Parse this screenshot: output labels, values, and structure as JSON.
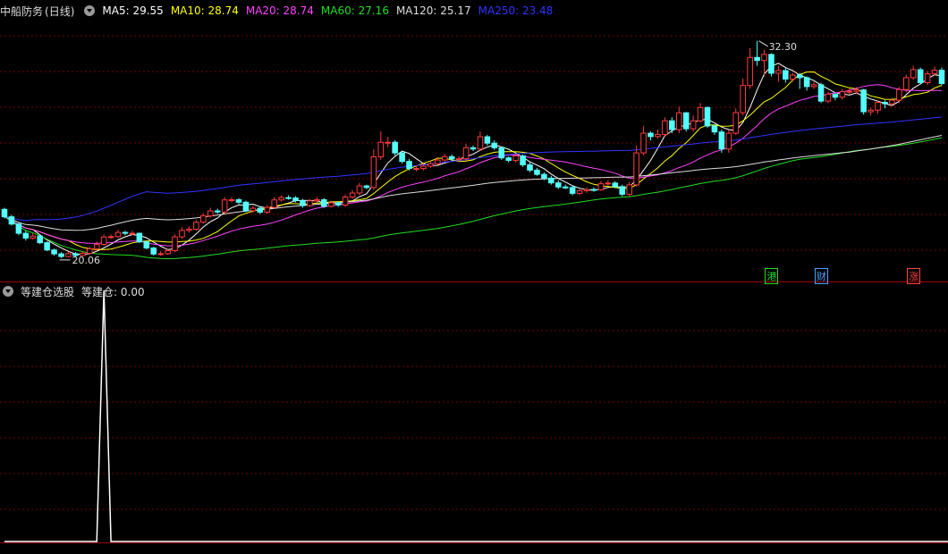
{
  "main_header": {
    "stock_name": "中船防务",
    "period": "(日线)",
    "ma_items": [
      {
        "label": "MA5: 29.55",
        "color": "#ffffff"
      },
      {
        "label": "MA10: 28.74",
        "color": "#ffff00"
      },
      {
        "label": "MA20: 28.74",
        "color": "#ff44ff"
      },
      {
        "label": "MA60: 27.16",
        "color": "#22dd22"
      },
      {
        "label": "MA120: 25.17",
        "color": "#dddddd"
      },
      {
        "label": "MA250: 23.48",
        "color": "#3333ff"
      }
    ]
  },
  "indicator_header": {
    "name": "等建仓选股",
    "value_label": "等建仓: 0.00"
  },
  "annotations": {
    "high_label": "32.30",
    "low_label": "20.06"
  },
  "events": [
    {
      "label": "港",
      "color": "#22dd22"
    },
    {
      "label": "财",
      "color": "#4aa0ff"
    },
    {
      "label": "涨",
      "color": "#ff4444"
    }
  ],
  "colors": {
    "up": "#ff3c3c",
    "down": "#54ffff",
    "grid": "#7a0000",
    "divider": "#a00000",
    "indicator_line": "#ffffff"
  },
  "chart_data": [
    {
      "type": "candlestick",
      "title": "中船防务 (日线)",
      "ylim": [
        19.5,
        33.5
      ],
      "x": [
        1,
        2,
        3,
        4,
        5,
        6,
        7,
        8,
        9,
        10,
        11,
        12,
        13,
        14,
        15,
        16,
        17,
        18,
        19,
        20,
        21,
        22,
        23,
        24,
        25,
        26,
        27,
        28,
        29,
        30,
        31,
        32,
        33,
        34,
        35,
        36,
        37,
        38,
        39,
        40,
        41,
        42,
        43,
        44,
        45,
        46,
        47,
        48,
        49,
        50,
        51,
        52,
        53,
        54,
        55,
        56,
        57,
        58,
        59,
        60,
        61,
        62,
        63,
        64,
        65,
        66,
        67,
        68,
        69,
        70,
        71,
        72,
        73,
        74,
        75,
        76,
        77,
        78,
        79,
        80,
        81,
        82,
        83,
        84,
        85,
        86,
        87,
        88,
        89,
        90,
        91,
        92,
        93,
        94,
        95,
        96,
        97,
        98,
        99,
        100,
        101,
        102,
        103,
        104,
        105,
        106,
        107,
        108,
        109,
        110,
        111,
        112,
        113,
        114,
        115,
        116,
        117,
        118,
        119,
        120,
        121,
        122,
        123,
        124,
        125,
        126,
        127,
        128,
        129,
        130,
        131,
        132,
        133,
        134,
        135,
        136,
        137,
        138,
        139,
        140,
        141,
        142,
        143,
        144,
        145,
        146,
        147,
        148,
        149,
        150,
        151,
        152,
        153,
        154,
        155,
        156,
        157,
        158,
        159,
        160,
        161,
        162,
        163,
        164,
        165,
        166,
        167,
        168,
        169,
        170,
        171,
        172,
        173,
        174,
        175
      ],
      "open": [
        22.81,
        22.39,
        21.98,
        21.46,
        21.19,
        21.3,
        20.93,
        20.52,
        20.3,
        20.15,
        20.31,
        20.21,
        20.33,
        20.58,
        20.83,
        21.25,
        21.27,
        21.51,
        21.46,
        21.46,
        20.98,
        20.63,
        20.29,
        20.31,
        20.48,
        21.26,
        21.62,
        21.69,
        22.08,
        22.44,
        22.72,
        22.66,
        23.34,
        23.35,
        23.21,
        22.73,
        22.87,
        22.65,
        22.92,
        23.34,
        23.47,
        23.45,
        23.3,
        23.02,
        23.29,
        23.35,
        22.98,
        23.18,
        23.05,
        23.5,
        23.73,
        24.13,
        24.04,
        25.77,
        26.59,
        26.59,
        25.99,
        25.51,
        25.11,
        25.11,
        25.24,
        25.38,
        25.59,
        25.78,
        25.65,
        25.66,
        26.28,
        26.21,
        26.9,
        26.54,
        26.28,
        25.71,
        25.57,
        25.82,
        25.32,
        25.02,
        24.78,
        24.57,
        24.3,
        24.07,
        24.04,
        23.71,
        23.86,
        23.93,
        23.91,
        24.25,
        24.29,
        24.09,
        23.66,
        24.19,
        25.99,
        27.1,
        26.91,
        27.03,
        27.8,
        27.3,
        28.25,
        27.35,
        27.8,
        28.55,
        27.51,
        27.17,
        26.21,
        27.1,
        28.26,
        29.79,
        31.37,
        31.2,
        31.54,
        30.48,
        30.63,
        30.15,
        30.38,
        30.23,
        29.73,
        29.83,
        28.91,
        29.3,
        29.13,
        29.44,
        29.46,
        29.54,
        28.31,
        28.4,
        28.84,
        28.76,
        28.96,
        29.56,
        30.23,
        30.68,
        29.95,
        30.45,
        30.65
      ],
      "close": [
        22.39,
        21.98,
        21.46,
        21.19,
        21.3,
        20.93,
        20.52,
        20.3,
        20.15,
        20.31,
        20.21,
        20.33,
        20.58,
        20.83,
        21.25,
        21.27,
        21.51,
        21.46,
        21.46,
        20.98,
        20.63,
        20.29,
        20.31,
        20.48,
        21.26,
        21.62,
        21.69,
        22.08,
        22.44,
        22.72,
        22.66,
        23.34,
        23.35,
        23.21,
        22.73,
        22.87,
        22.65,
        22.92,
        23.34,
        23.47,
        23.45,
        23.3,
        23.02,
        23.29,
        23.35,
        22.98,
        23.18,
        23.05,
        23.5,
        23.73,
        24.13,
        24.04,
        25.77,
        26.59,
        26.59,
        25.99,
        25.51,
        25.11,
        25.11,
        25.24,
        25.38,
        25.59,
        25.78,
        25.65,
        25.66,
        26.28,
        26.21,
        26.9,
        26.54,
        26.28,
        25.71,
        25.57,
        25.82,
        25.32,
        25.02,
        24.78,
        24.57,
        24.3,
        24.07,
        24.04,
        23.71,
        23.86,
        23.93,
        23.91,
        24.25,
        24.29,
        24.09,
        23.66,
        24.19,
        25.99,
        27.1,
        26.91,
        27.03,
        27.8,
        27.3,
        28.25,
        27.35,
        27.8,
        28.55,
        27.51,
        27.17,
        26.21,
        27.1,
        28.26,
        29.79,
        31.37,
        31.2,
        31.54,
        30.48,
        30.63,
        30.15,
        30.38,
        30.23,
        29.73,
        29.83,
        28.91,
        29.3,
        29.13,
        29.44,
        29.46,
        29.54,
        28.31,
        28.4,
        28.84,
        28.76,
        28.96,
        29.56,
        30.23,
        30.68,
        29.95,
        30.45,
        30.65,
        29.9
      ],
      "high": [
        22.9,
        22.5,
        22.1,
        21.6,
        21.45,
        21.4,
        21.0,
        20.6,
        20.4,
        20.4,
        20.4,
        20.45,
        20.7,
        21.0,
        21.4,
        21.4,
        21.65,
        21.6,
        21.6,
        21.5,
        21.05,
        20.7,
        20.45,
        20.6,
        21.4,
        21.8,
        21.85,
        22.2,
        22.6,
        22.9,
        22.85,
        23.5,
        23.5,
        23.45,
        23.3,
        23.0,
        22.95,
        23.05,
        23.5,
        23.6,
        23.6,
        23.55,
        23.4,
        23.4,
        23.5,
        23.45,
        23.3,
        23.25,
        23.65,
        23.9,
        24.3,
        24.2,
        26.2,
        27.2,
        26.9,
        26.7,
        26.1,
        25.65,
        25.3,
        25.4,
        25.5,
        25.75,
        25.95,
        25.9,
        25.8,
        26.5,
        26.4,
        27.2,
        27.0,
        26.7,
        26.35,
        25.8,
        25.95,
        25.9,
        25.45,
        25.15,
        24.9,
        24.7,
        24.45,
        24.2,
        24.15,
        23.95,
        24.05,
        24.05,
        24.4,
        24.45,
        24.4,
        24.2,
        24.35,
        26.4,
        27.5,
        27.2,
        27.3,
        28.0,
        28.0,
        28.6,
        28.3,
        28.1,
        28.8,
        28.6,
        27.6,
        27.3,
        27.3,
        28.5,
        30.2,
        31.9,
        32.3,
        31.8,
        31.6,
        30.9,
        30.8,
        30.5,
        30.5,
        30.3,
        30.0,
        29.95,
        29.45,
        29.25,
        29.6,
        29.65,
        29.7,
        29.6,
        28.55,
        28.95,
        28.95,
        29.1,
        29.7,
        30.4,
        30.9,
        30.8,
        30.6,
        30.85,
        30.8
      ],
      "low": [
        22.3,
        21.9,
        21.35,
        21.05,
        21.1,
        20.85,
        20.45,
        20.2,
        20.06,
        20.1,
        20.1,
        20.15,
        20.25,
        20.5,
        20.75,
        21.15,
        21.2,
        21.35,
        21.35,
        20.9,
        20.55,
        20.2,
        20.2,
        20.25,
        20.4,
        21.15,
        21.5,
        21.6,
        22.0,
        22.35,
        22.55,
        22.55,
        23.2,
        23.1,
        22.65,
        22.6,
        22.55,
        22.55,
        22.85,
        23.25,
        23.35,
        23.2,
        22.9,
        22.95,
        23.2,
        22.9,
        22.9,
        22.95,
        22.95,
        23.4,
        23.6,
        23.95,
        23.9,
        25.6,
        26.3,
        25.85,
        25.4,
        25.0,
        24.95,
        25.0,
        25.15,
        25.3,
        25.5,
        25.55,
        25.5,
        25.55,
        26.1,
        26.1,
        26.4,
        26.15,
        25.6,
        25.45,
        25.45,
        25.2,
        24.9,
        24.7,
        24.45,
        24.2,
        23.95,
        23.95,
        23.6,
        23.6,
        23.75,
        23.8,
        23.85,
        24.15,
        24.0,
        23.55,
        23.55,
        24.1,
        25.85,
        26.7,
        26.8,
        26.9,
        27.1,
        27.1,
        27.2,
        27.2,
        27.7,
        27.4,
        27.0,
        26.0,
        26.0,
        27.0,
        28.1,
        29.6,
        30.9,
        30.3,
        30.3,
        30.0,
        29.95,
        30.0,
        29.6,
        29.5,
        29.6,
        28.8,
        28.8,
        28.95,
        29.0,
        29.3,
        29.3,
        28.15,
        28.1,
        28.2,
        28.5,
        28.6,
        28.8,
        29.4,
        30.1,
        29.85,
        29.8,
        30.35,
        29.8
      ]
    },
    {
      "type": "line",
      "title": "等建仓选股",
      "ylabel": "等建仓",
      "ylim": [
        0,
        1
      ],
      "x": [
        1,
        2,
        3,
        4,
        5,
        6,
        7,
        8,
        9,
        10,
        11,
        12,
        13,
        14,
        15,
        16,
        17,
        18,
        19,
        20,
        21,
        22,
        23,
        24,
        25,
        26,
        27,
        28,
        29,
        30,
        31,
        32,
        33,
        34,
        35,
        36,
        37,
        38,
        39,
        40,
        41,
        42,
        43,
        44,
        45,
        46,
        47,
        48,
        49,
        50,
        51,
        52,
        53,
        54,
        55,
        56,
        57,
        58,
        59,
        60,
        61,
        62,
        63,
        64,
        65,
        66,
        67,
        68,
        69,
        70,
        71,
        72,
        73,
        74,
        75,
        76,
        77,
        78,
        79,
        80,
        81,
        82,
        83,
        84,
        85,
        86,
        87,
        88,
        89,
        90,
        91,
        92,
        93,
        94,
        95,
        96,
        97,
        98,
        99,
        100,
        101,
        102,
        103,
        104,
        105,
        106,
        107,
        108,
        109,
        110,
        111,
        112,
        113,
        114,
        115,
        116,
        117,
        118,
        119,
        120,
        121,
        122,
        123,
        124,
        125,
        126,
        127,
        128,
        129,
        130,
        131,
        132,
        133,
        134,
        135,
        136,
        137,
        138,
        139,
        140,
        141,
        142,
        143,
        144,
        145,
        146,
        147,
        148,
        149,
        150,
        151,
        152,
        153,
        154,
        155,
        156,
        157,
        158,
        159,
        160,
        161,
        162,
        163,
        164,
        165,
        166,
        167,
        168,
        169,
        170,
        171,
        172,
        173,
        174,
        175
      ],
      "series": [
        {
          "name": "等建仓",
          "values": [
            0,
            0,
            0,
            0,
            0,
            0,
            0,
            0,
            0,
            0,
            0,
            0,
            0,
            0,
            1,
            0,
            0,
            0,
            0,
            0,
            0,
            0,
            0,
            0,
            0,
            0,
            0,
            0,
            0,
            0,
            0,
            0,
            0,
            0,
            0,
            0,
            0,
            0,
            0,
            0,
            0,
            0,
            0,
            0,
            0,
            0,
            0,
            0,
            0,
            0,
            0,
            0,
            0,
            0,
            0,
            0,
            0,
            0,
            0,
            0,
            0,
            0,
            0,
            0,
            0,
            0,
            0,
            0,
            0,
            0,
            0,
            0,
            0,
            0,
            0,
            0,
            0,
            0,
            0,
            0,
            0,
            0,
            0,
            0,
            0,
            0,
            0,
            0,
            0,
            0,
            0,
            0,
            0,
            0,
            0,
            0,
            0,
            0,
            0,
            0,
            0,
            0,
            0,
            0,
            0,
            0,
            0,
            0,
            0,
            0,
            0,
            0,
            0,
            0,
            0,
            0,
            0,
            0,
            0,
            0,
            0,
            0,
            0,
            0,
            0,
            0,
            0,
            0,
            0,
            0,
            0,
            0,
            0,
            0,
            0,
            0,
            0,
            0,
            0,
            0,
            0,
            0,
            0,
            0,
            0,
            0,
            0,
            0,
            0,
            0,
            0,
            0,
            0,
            0,
            0,
            0,
            0,
            0,
            0,
            0,
            0,
            0,
            0,
            0,
            0,
            0,
            0,
            0,
            0,
            0,
            0,
            0,
            0,
            0,
            0
          ]
        }
      ]
    }
  ]
}
